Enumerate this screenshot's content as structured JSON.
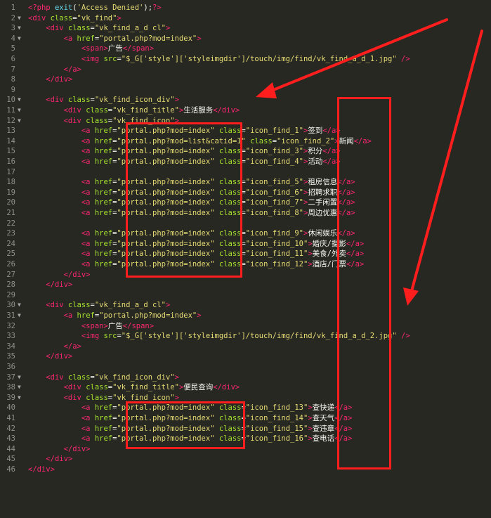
{
  "lines": [
    [
      [
        "t-php",
        "<?php "
      ],
      [
        "t-fn",
        "exit"
      ],
      [
        "t-plain",
        "("
      ],
      [
        "t-str",
        "'Access Denied'"
      ],
      [
        "t-plain",
        ");"
      ],
      [
        "t-php",
        "?>"
      ]
    ],
    [
      [
        "t-tag",
        "<div "
      ],
      [
        "t-attr",
        "class"
      ],
      [
        "t-plain",
        "="
      ],
      [
        "t-str",
        "\"vk_find\""
      ],
      [
        "t-tag",
        ">"
      ]
    ],
    [
      [
        "t-plain",
        "    "
      ],
      [
        "t-tag",
        "<div "
      ],
      [
        "t-attr",
        "class"
      ],
      [
        "t-plain",
        "="
      ],
      [
        "t-str",
        "\"vk_find_a_d cl\""
      ],
      [
        "t-tag",
        ">"
      ]
    ],
    [
      [
        "t-plain",
        "        "
      ],
      [
        "t-tag",
        "<a "
      ],
      [
        "t-attr",
        "href"
      ],
      [
        "t-plain",
        "="
      ],
      [
        "t-str",
        "\"portal.php?mod=index\""
      ],
      [
        "t-tag",
        ">"
      ]
    ],
    [
      [
        "t-plain",
        "            "
      ],
      [
        "t-tag",
        "<span>"
      ],
      [
        "t-text",
        "广告"
      ],
      [
        "t-tag",
        "</span>"
      ]
    ],
    [
      [
        "t-plain",
        "            "
      ],
      [
        "t-tag",
        "<img "
      ],
      [
        "t-attr",
        "src"
      ],
      [
        "t-plain",
        "="
      ],
      [
        "t-str",
        "\"$_G['style']['styleimgdir']/touch/img/find/vk_find_a_d_1.jpg\""
      ],
      [
        "t-tag",
        " />"
      ]
    ],
    [
      [
        "t-plain",
        "        "
      ],
      [
        "t-tag",
        "</a>"
      ]
    ],
    [
      [
        "t-plain",
        "    "
      ],
      [
        "t-tag",
        "</div>"
      ]
    ],
    [],
    [
      [
        "t-plain",
        "    "
      ],
      [
        "t-tag",
        "<div "
      ],
      [
        "t-attr",
        "class"
      ],
      [
        "t-plain",
        "="
      ],
      [
        "t-str",
        "\"vk_find_icon_div\""
      ],
      [
        "t-tag",
        ">"
      ]
    ],
    [
      [
        "t-plain",
        "        "
      ],
      [
        "t-tag",
        "<div "
      ],
      [
        "t-attr",
        "class"
      ],
      [
        "t-plain",
        "="
      ],
      [
        "t-str",
        "\"vk_find_title\""
      ],
      [
        "t-tag",
        ">"
      ],
      [
        "t-text",
        "生活服务"
      ],
      [
        "t-tag",
        "</div>"
      ]
    ],
    [
      [
        "t-plain",
        "        "
      ],
      [
        "t-tag",
        "<div "
      ],
      [
        "t-attr",
        "class"
      ],
      [
        "t-plain",
        "="
      ],
      [
        "t-str",
        "\"vk_find_icon\""
      ],
      [
        "t-tag",
        ">"
      ]
    ],
    [
      [
        "t-plain",
        "            "
      ],
      [
        "t-tag",
        "<a "
      ],
      [
        "t-attr",
        "href"
      ],
      [
        "t-plain",
        "="
      ],
      [
        "t-str",
        "\"portal.php?mod=index\""
      ],
      [
        "t-attr",
        " class"
      ],
      [
        "t-plain",
        "="
      ],
      [
        "t-str",
        "\"icon_find_1\""
      ],
      [
        "t-tag",
        ">"
      ],
      [
        "t-text",
        "签到"
      ],
      [
        "t-tag",
        "</a>"
      ]
    ],
    [
      [
        "t-plain",
        "            "
      ],
      [
        "t-tag",
        "<a "
      ],
      [
        "t-attr",
        "href"
      ],
      [
        "t-plain",
        "="
      ],
      [
        "t-str",
        "\"portal.php?mod=list&catid=1\""
      ],
      [
        "t-attr",
        " class"
      ],
      [
        "t-plain",
        "="
      ],
      [
        "t-str",
        "\"icon_find_2\""
      ],
      [
        "t-tag",
        ">"
      ],
      [
        "t-text",
        "新闻"
      ],
      [
        "t-tag",
        "</a>"
      ]
    ],
    [
      [
        "t-plain",
        "            "
      ],
      [
        "t-tag",
        "<a "
      ],
      [
        "t-attr",
        "href"
      ],
      [
        "t-plain",
        "="
      ],
      [
        "t-str",
        "\"portal.php?mod=index\""
      ],
      [
        "t-attr",
        " class"
      ],
      [
        "t-plain",
        "="
      ],
      [
        "t-str",
        "\"icon_find_3\""
      ],
      [
        "t-tag",
        ">"
      ],
      [
        "t-text",
        "积分"
      ],
      [
        "t-tag",
        "</a>"
      ]
    ],
    [
      [
        "t-plain",
        "            "
      ],
      [
        "t-tag",
        "<a "
      ],
      [
        "t-attr",
        "href"
      ],
      [
        "t-plain",
        "="
      ],
      [
        "t-str",
        "\"portal.php?mod=index\""
      ],
      [
        "t-attr",
        " class"
      ],
      [
        "t-plain",
        "="
      ],
      [
        "t-str",
        "\"icon_find_4\""
      ],
      [
        "t-tag",
        ">"
      ],
      [
        "t-text",
        "活动"
      ],
      [
        "t-tag",
        "</a>"
      ]
    ],
    [],
    [
      [
        "t-plain",
        "            "
      ],
      [
        "t-tag",
        "<a "
      ],
      [
        "t-attr",
        "href"
      ],
      [
        "t-plain",
        "="
      ],
      [
        "t-str",
        "\"portal.php?mod=index\""
      ],
      [
        "t-attr",
        " class"
      ],
      [
        "t-plain",
        "="
      ],
      [
        "t-str",
        "\"icon_find_5\""
      ],
      [
        "t-tag",
        ">"
      ],
      [
        "t-text",
        "租房信息"
      ],
      [
        "t-tag",
        "</a>"
      ]
    ],
    [
      [
        "t-plain",
        "            "
      ],
      [
        "t-tag",
        "<a "
      ],
      [
        "t-attr",
        "href"
      ],
      [
        "t-plain",
        "="
      ],
      [
        "t-str",
        "\"portal.php?mod=index\""
      ],
      [
        "t-attr",
        " class"
      ],
      [
        "t-plain",
        "="
      ],
      [
        "t-str",
        "\"icon_find_6\""
      ],
      [
        "t-tag",
        ">"
      ],
      [
        "t-text",
        "招聘求职"
      ],
      [
        "t-tag",
        "</a>"
      ]
    ],
    [
      [
        "t-plain",
        "            "
      ],
      [
        "t-tag",
        "<a "
      ],
      [
        "t-attr",
        "href"
      ],
      [
        "t-plain",
        "="
      ],
      [
        "t-str",
        "\"portal.php?mod=index\""
      ],
      [
        "t-attr",
        " class"
      ],
      [
        "t-plain",
        "="
      ],
      [
        "t-str",
        "\"icon_find_7\""
      ],
      [
        "t-tag",
        ">"
      ],
      [
        "t-text",
        "二手闲置"
      ],
      [
        "t-tag",
        "</a>"
      ]
    ],
    [
      [
        "t-plain",
        "            "
      ],
      [
        "t-tag",
        "<a "
      ],
      [
        "t-attr",
        "href"
      ],
      [
        "t-plain",
        "="
      ],
      [
        "t-str",
        "\"portal.php?mod=index\""
      ],
      [
        "t-attr",
        " class"
      ],
      [
        "t-plain",
        "="
      ],
      [
        "t-str",
        "\"icon_find_8\""
      ],
      [
        "t-tag",
        ">"
      ],
      [
        "t-text",
        "周边优惠"
      ],
      [
        "t-tag",
        "</a>"
      ]
    ],
    [],
    [
      [
        "t-plain",
        "            "
      ],
      [
        "t-tag",
        "<a "
      ],
      [
        "t-attr",
        "href"
      ],
      [
        "t-plain",
        "="
      ],
      [
        "t-str",
        "\"portal.php?mod=index\""
      ],
      [
        "t-attr",
        " class"
      ],
      [
        "t-plain",
        "="
      ],
      [
        "t-str",
        "\"icon_find_9\""
      ],
      [
        "t-tag",
        ">"
      ],
      [
        "t-text",
        "休闲娱乐"
      ],
      [
        "t-tag",
        "</a>"
      ]
    ],
    [
      [
        "t-plain",
        "            "
      ],
      [
        "t-tag",
        "<a "
      ],
      [
        "t-attr",
        "href"
      ],
      [
        "t-plain",
        "="
      ],
      [
        "t-str",
        "\"portal.php?mod=index\""
      ],
      [
        "t-attr",
        " class"
      ],
      [
        "t-plain",
        "="
      ],
      [
        "t-str",
        "\"icon_find_10\""
      ],
      [
        "t-tag",
        ">"
      ],
      [
        "t-text",
        "婚庆/摄影"
      ],
      [
        "t-tag",
        "</a>"
      ]
    ],
    [
      [
        "t-plain",
        "            "
      ],
      [
        "t-tag",
        "<a "
      ],
      [
        "t-attr",
        "href"
      ],
      [
        "t-plain",
        "="
      ],
      [
        "t-str",
        "\"portal.php?mod=index\""
      ],
      [
        "t-attr",
        " class"
      ],
      [
        "t-plain",
        "="
      ],
      [
        "t-str",
        "\"icon_find_11\""
      ],
      [
        "t-tag",
        ">"
      ],
      [
        "t-text",
        "美食/外卖"
      ],
      [
        "t-tag",
        "</a>"
      ]
    ],
    [
      [
        "t-plain",
        "            "
      ],
      [
        "t-tag",
        "<a "
      ],
      [
        "t-attr",
        "href"
      ],
      [
        "t-plain",
        "="
      ],
      [
        "t-str",
        "\"portal.php?mod=index\""
      ],
      [
        "t-attr",
        " class"
      ],
      [
        "t-plain",
        "="
      ],
      [
        "t-str",
        "\"icon_find_12\""
      ],
      [
        "t-tag",
        ">"
      ],
      [
        "t-text",
        "酒店/门票"
      ],
      [
        "t-tag",
        "</a>"
      ]
    ],
    [
      [
        "t-plain",
        "        "
      ],
      [
        "t-tag",
        "</div>"
      ]
    ],
    [
      [
        "t-plain",
        "    "
      ],
      [
        "t-tag",
        "</div>"
      ]
    ],
    [],
    [
      [
        "t-plain",
        "    "
      ],
      [
        "t-tag",
        "<div "
      ],
      [
        "t-attr",
        "class"
      ],
      [
        "t-plain",
        "="
      ],
      [
        "t-str",
        "\"vk_find_a_d cl\""
      ],
      [
        "t-tag",
        ">"
      ]
    ],
    [
      [
        "t-plain",
        "        "
      ],
      [
        "t-tag",
        "<a "
      ],
      [
        "t-attr",
        "href"
      ],
      [
        "t-plain",
        "="
      ],
      [
        "t-str",
        "\"portal.php?mod=index\""
      ],
      [
        "t-tag",
        ">"
      ]
    ],
    [
      [
        "t-plain",
        "            "
      ],
      [
        "t-tag",
        "<span>"
      ],
      [
        "t-text",
        "广告"
      ],
      [
        "t-tag",
        "</span>"
      ]
    ],
    [
      [
        "t-plain",
        "            "
      ],
      [
        "t-tag",
        "<img "
      ],
      [
        "t-attr",
        "src"
      ],
      [
        "t-plain",
        "="
      ],
      [
        "t-str",
        "\"$_G['style']['styleimgdir']/touch/img/find/vk_find_a_d_2.jpg\""
      ],
      [
        "t-tag",
        " />"
      ]
    ],
    [
      [
        "t-plain",
        "        "
      ],
      [
        "t-tag",
        "</a>"
      ]
    ],
    [
      [
        "t-plain",
        "    "
      ],
      [
        "t-tag",
        "</div>"
      ]
    ],
    [],
    [
      [
        "t-plain",
        "    "
      ],
      [
        "t-tag",
        "<div "
      ],
      [
        "t-attr",
        "class"
      ],
      [
        "t-plain",
        "="
      ],
      [
        "t-str",
        "\"vk_find_icon_div\""
      ],
      [
        "t-tag",
        ">"
      ]
    ],
    [
      [
        "t-plain",
        "        "
      ],
      [
        "t-tag",
        "<div "
      ],
      [
        "t-attr",
        "class"
      ],
      [
        "t-plain",
        "="
      ],
      [
        "t-str",
        "\"vk_find_title\""
      ],
      [
        "t-tag",
        ">"
      ],
      [
        "t-text",
        "便民查询"
      ],
      [
        "t-tag",
        "</div>"
      ]
    ],
    [
      [
        "t-plain",
        "        "
      ],
      [
        "t-tag",
        "<div "
      ],
      [
        "t-attr",
        "class"
      ],
      [
        "t-plain",
        "="
      ],
      [
        "t-str",
        "\"vk_find_icon\""
      ],
      [
        "t-tag",
        ">"
      ]
    ],
    [
      [
        "t-plain",
        "            "
      ],
      [
        "t-tag",
        "<a "
      ],
      [
        "t-attr",
        "href"
      ],
      [
        "t-plain",
        "="
      ],
      [
        "t-str",
        "\"portal.php?mod=index\""
      ],
      [
        "t-attr",
        " class"
      ],
      [
        "t-plain",
        "="
      ],
      [
        "t-str",
        "\"icon_find_13\""
      ],
      [
        "t-tag",
        ">"
      ],
      [
        "t-text",
        "查快递"
      ],
      [
        "t-tag",
        "</a>"
      ]
    ],
    [
      [
        "t-plain",
        "            "
      ],
      [
        "t-tag",
        "<a "
      ],
      [
        "t-attr",
        "href"
      ],
      [
        "t-plain",
        "="
      ],
      [
        "t-str",
        "\"portal.php?mod=index\""
      ],
      [
        "t-attr",
        " class"
      ],
      [
        "t-plain",
        "="
      ],
      [
        "t-str",
        "\"icon_find_14\""
      ],
      [
        "t-tag",
        ">"
      ],
      [
        "t-text",
        "查天气"
      ],
      [
        "t-tag",
        "</a>"
      ]
    ],
    [
      [
        "t-plain",
        "            "
      ],
      [
        "t-tag",
        "<a "
      ],
      [
        "t-attr",
        "href"
      ],
      [
        "t-plain",
        "="
      ],
      [
        "t-str",
        "\"portal.php?mod=index\""
      ],
      [
        "t-attr",
        " class"
      ],
      [
        "t-plain",
        "="
      ],
      [
        "t-str",
        "\"icon_find_15\""
      ],
      [
        "t-tag",
        ">"
      ],
      [
        "t-text",
        "查违章"
      ],
      [
        "t-tag",
        "</a>"
      ]
    ],
    [
      [
        "t-plain",
        "            "
      ],
      [
        "t-tag",
        "<a "
      ],
      [
        "t-attr",
        "href"
      ],
      [
        "t-plain",
        "="
      ],
      [
        "t-str",
        "\"portal.php?mod=index\""
      ],
      [
        "t-attr",
        " class"
      ],
      [
        "t-plain",
        "="
      ],
      [
        "t-str",
        "\"icon_find_16\""
      ],
      [
        "t-tag",
        ">"
      ],
      [
        "t-text",
        "查电话"
      ],
      [
        "t-tag",
        "</a>"
      ]
    ],
    [
      [
        "t-plain",
        "        "
      ],
      [
        "t-tag",
        "</div>"
      ]
    ],
    [
      [
        "t-plain",
        "    "
      ],
      [
        "t-tag",
        "</div>"
      ]
    ],
    [
      [
        "t-tag",
        "</div>"
      ]
    ]
  ],
  "fold_markers": [
    2,
    3,
    4,
    10,
    11,
    12,
    30,
    31,
    37,
    38,
    39
  ],
  "colors": {
    "background": "#272822",
    "line_number": "#8f908a",
    "annotation_red": "#ff1e1e"
  },
  "icons": {
    "fold": "fold-arrow-icon"
  }
}
